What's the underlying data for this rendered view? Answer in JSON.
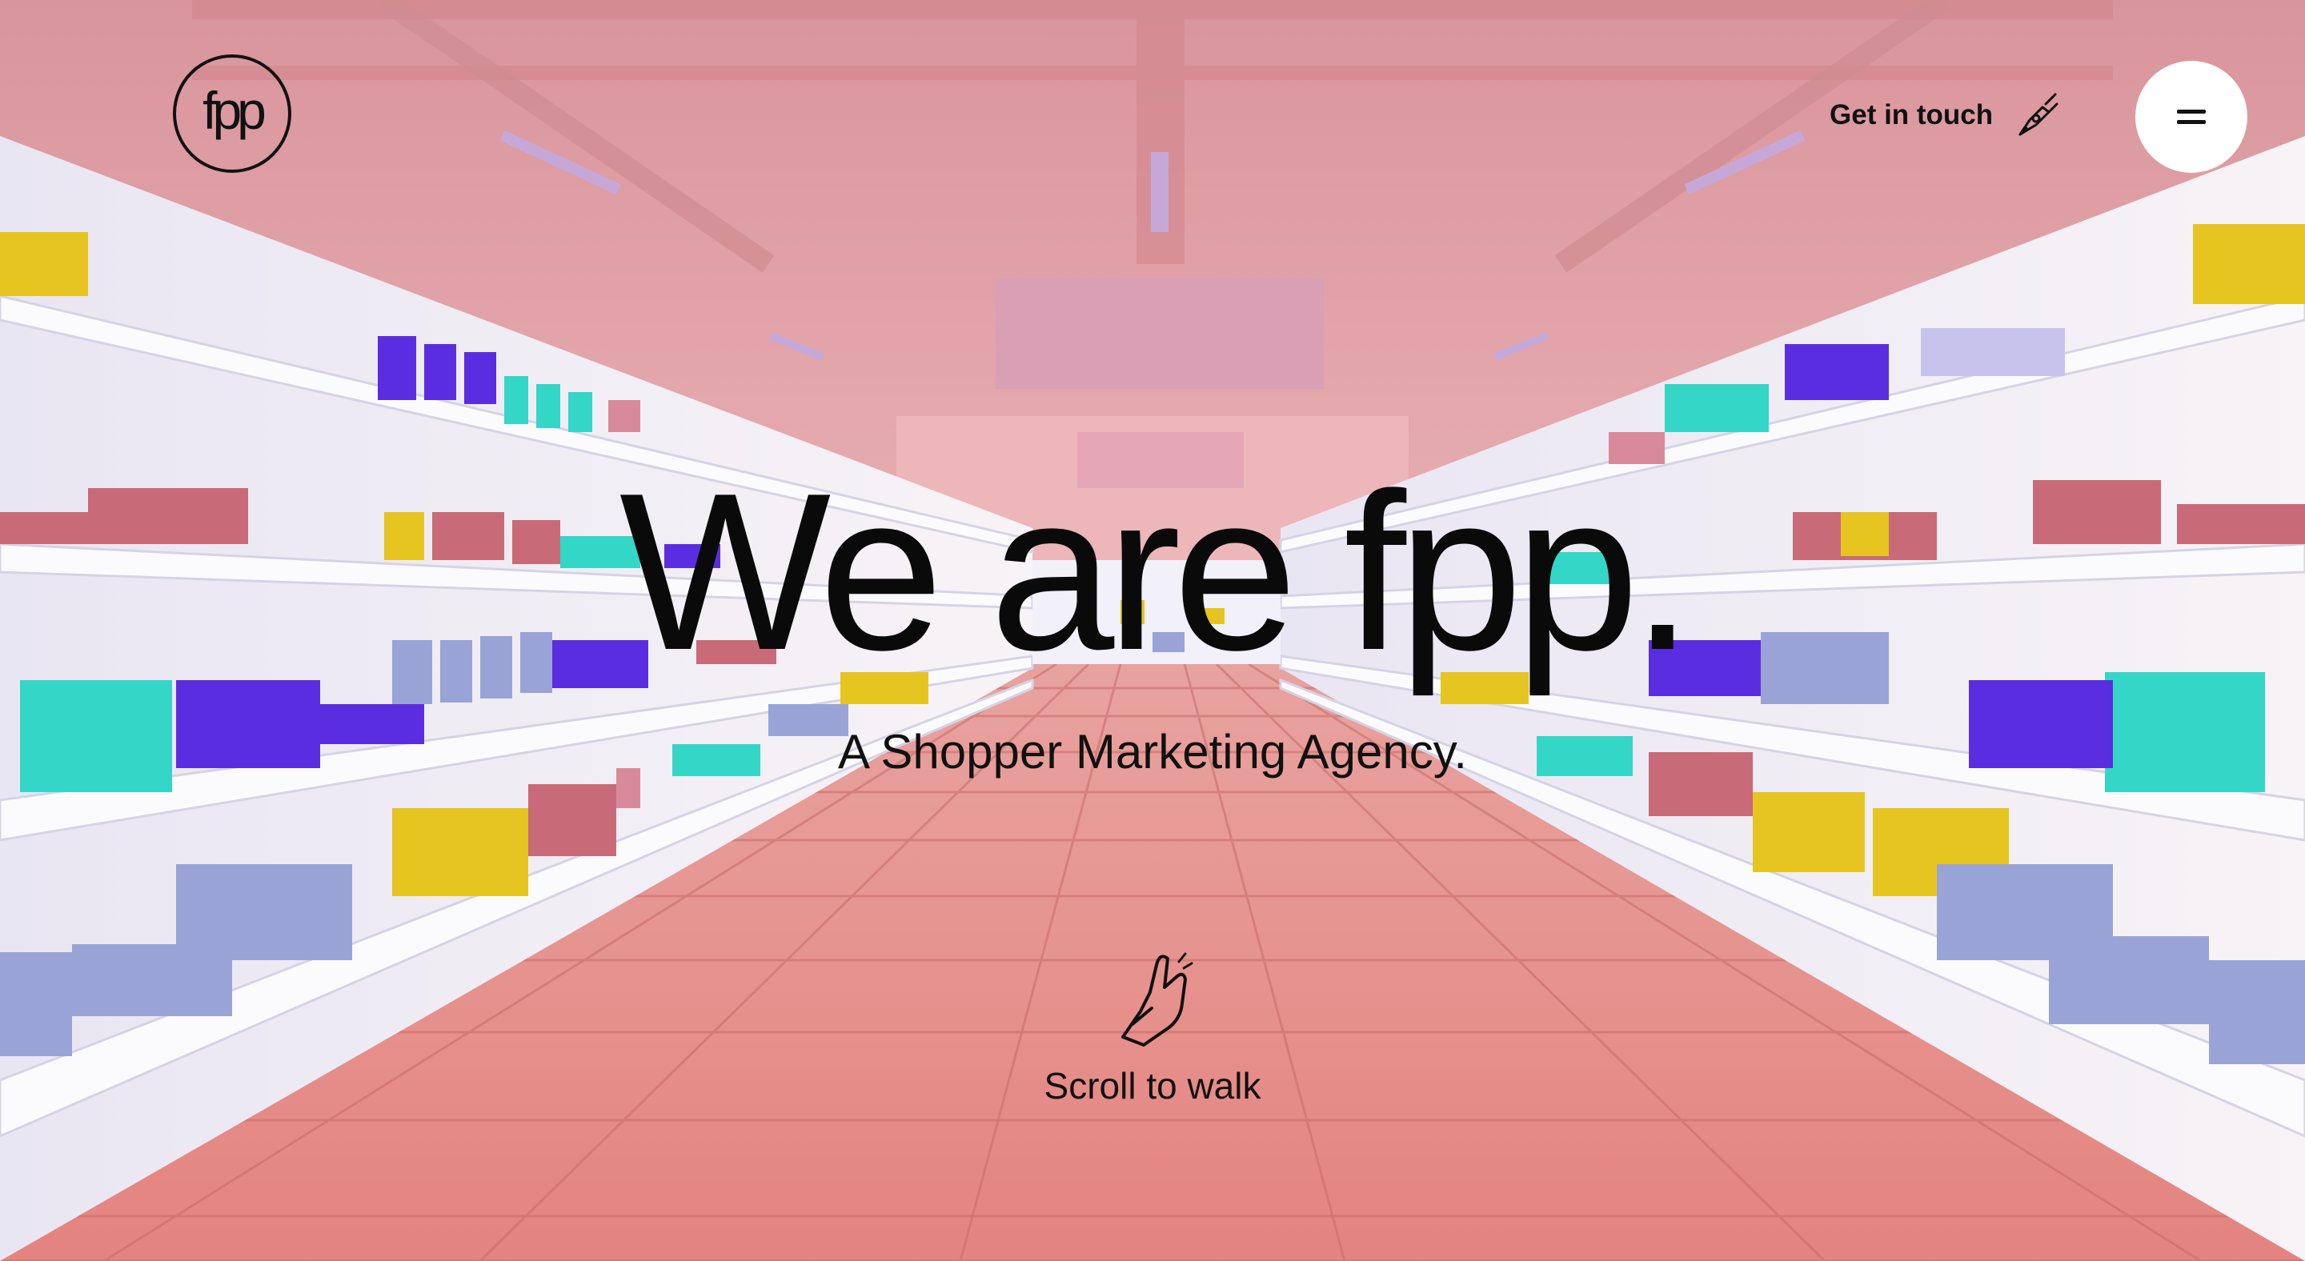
{
  "brand": {
    "logo_text": "fpp",
    "logo_icon": "fpp-circle-logo"
  },
  "header": {
    "contact_label": "Get in touch",
    "contact_icon": "pen-nib-icon",
    "menu_icon": "hamburger-menu-icon"
  },
  "hero": {
    "title": "We are fpp.",
    "subtitle": "A Shopper Marketing Agency."
  },
  "scroll_hint": {
    "label": "Scroll to walk",
    "icon": "walking-fingers-icon"
  },
  "colors": {
    "ceiling": "#e3a2a7",
    "floor": "#e58d88",
    "shelf": "#f4f4fb",
    "product_purple": "#5a2ee0",
    "product_teal": "#34d6c8",
    "product_yellow": "#e6c520",
    "product_red": "#c96a78",
    "product_lavender": "#9aa3d6"
  }
}
